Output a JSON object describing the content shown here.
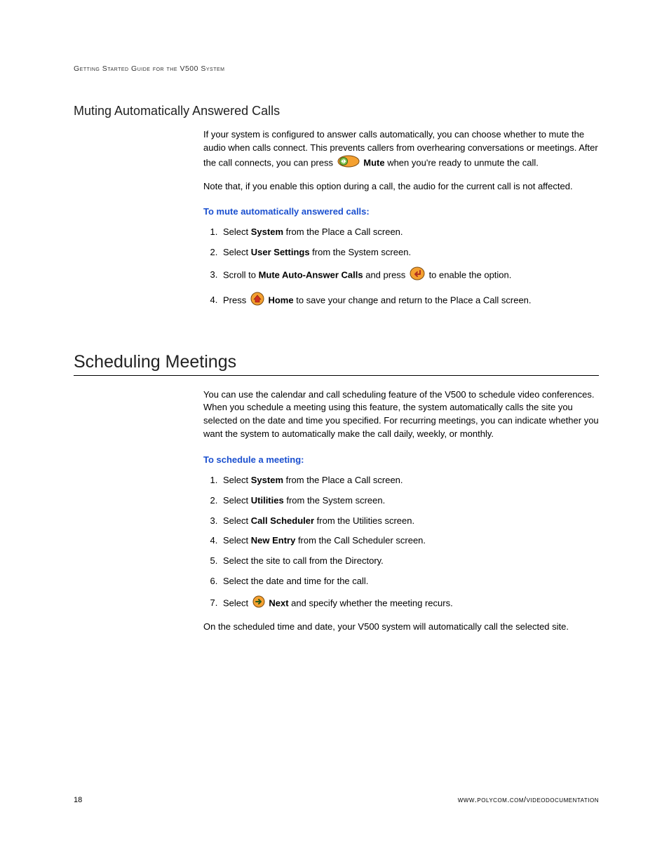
{
  "header": {
    "running": "Getting Started Guide for the V500 System"
  },
  "section1": {
    "title": "Muting Automatically Answered Calls",
    "para1": "If your system is configured to answer calls automatically, you can choose whether to mute the audio when calls connect. This prevents callers from overhearing conversations or meetings. After the call connects, you can press ",
    "mute_label": "Mute",
    "para1_tail": " when you're ready to unmute the call.",
    "para2": "Note that, if you enable this option during a call, the audio for the current call is not affected.",
    "task_heading": "To mute automatically answered calls:",
    "steps": {
      "s1a": "Select ",
      "s1b": "System",
      "s1c": " from the Place a Call screen.",
      "s2a": "Select ",
      "s2b": "User Settings",
      "s2c": " from the System screen.",
      "s3a": "Scroll to ",
      "s3b": "Mute Auto-Answer Calls",
      "s3c": " and press ",
      "s3d": " to enable the option.",
      "s4a": "Press ",
      "s4b": "Home",
      "s4c": " to save your change and return to the Place a Call screen."
    }
  },
  "section2": {
    "title": "Scheduling Meetings",
    "para1": "You can use the calendar and call scheduling feature of the V500 to schedule video conferences. When you schedule a meeting using this feature, the system automatically calls the site you selected on the date and time you specified. For recurring meetings, you can indicate whether you want the system to automatically make the call daily, weekly, or monthly.",
    "task_heading": "To schedule a meeting:",
    "steps": {
      "s1a": "Select ",
      "s1b": "System",
      "s1c": " from the Place a Call screen.",
      "s2a": "Select ",
      "s2b": "Utilities",
      "s2c": " from the System screen.",
      "s3a": "Select ",
      "s3b": "Call Scheduler",
      "s3c": " from the Utilities screen.",
      "s4a": "Select ",
      "s4b": "New Entry",
      "s4c": " from the Call Scheduler screen.",
      "s5": "Select the site to call from the Directory.",
      "s6": "Select the date and time for the call.",
      "s7a": "Select ",
      "s7b": "Next",
      "s7c": " and specify whether the meeting recurs."
    },
    "closing": "On the scheduled time and date, your V500 system will automatically call the selected site."
  },
  "footer": {
    "page": "18",
    "url": "www.polycom.com/videodocumentation"
  }
}
